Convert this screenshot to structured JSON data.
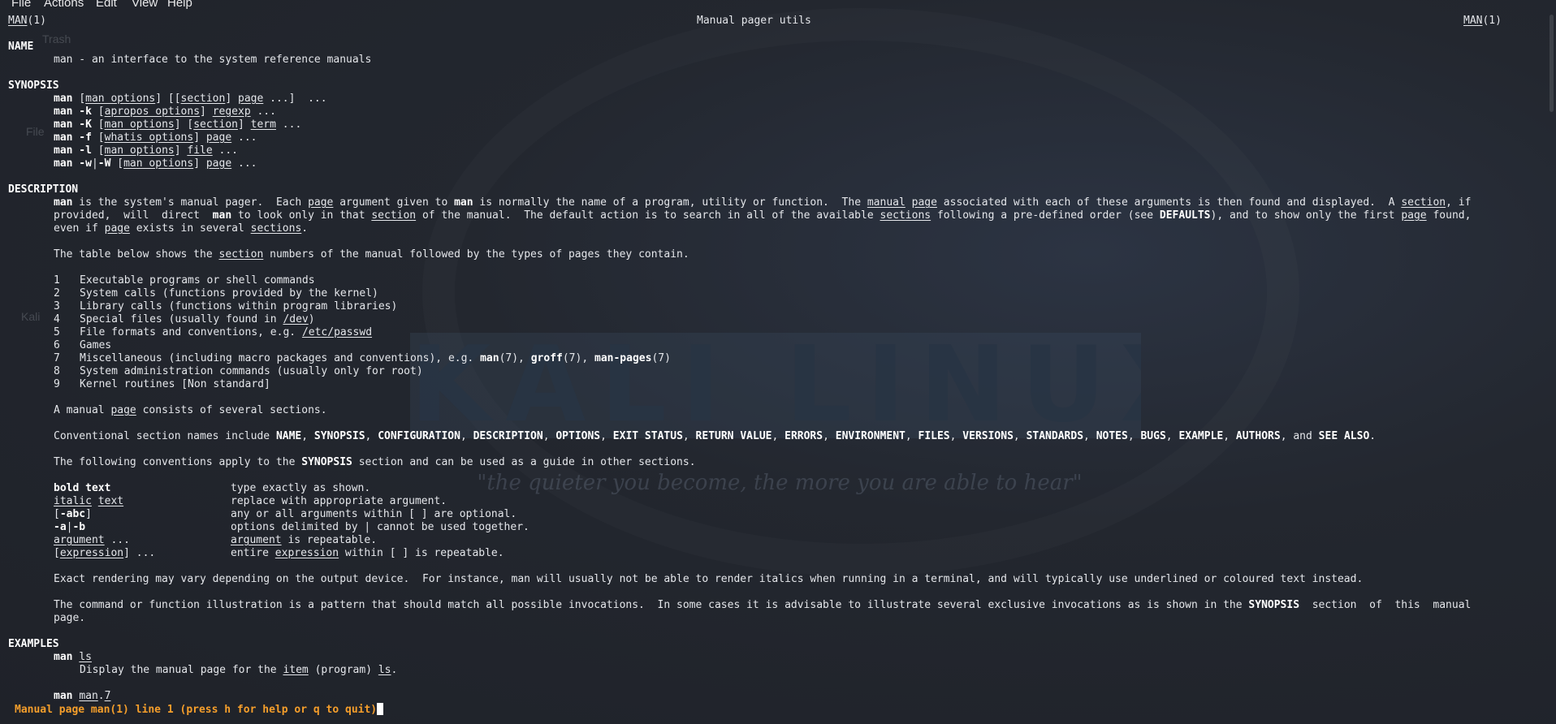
{
  "menubar": {
    "items": [
      "File",
      "Actions",
      "Edit",
      "View",
      "Help"
    ]
  },
  "desktop": {
    "icon_labels": [
      "Trash",
      "File",
      "Kali"
    ],
    "wallpaper_title": "KALI LINUX",
    "wallpaper_quote": "\"the quieter you become, the more you are able to hear\""
  },
  "header": {
    "left_name": "MAN",
    "left_sect": "(1)",
    "center": "Manual pager utils",
    "right_name": "MAN",
    "right_sect": "(1)"
  },
  "sections": {
    "name": "NAME",
    "synopsis": "SYNOPSIS",
    "description": "DESCRIPTION",
    "examples": "EXAMPLES"
  },
  "name_line": "man - an interface to the system reference manuals",
  "synopsis": {
    "man": "man",
    "man_k": "man -k",
    "man_K": "man -K",
    "man_f": "man -f",
    "man_l": "man -l",
    "man_w": "man -w",
    "bar": "|",
    "man_W": "-W",
    "man_options": "man options",
    "section": "section",
    "page": "page",
    "apropos_options": "apropos options",
    "regexp": "regexp",
    "term": "term",
    "whatis_options": "whatis options",
    "file": "file",
    "ellipsis": "...",
    "lb": "[",
    "rb": "]",
    "llb": "[[",
    "sep": "] ",
    "tail": " ...",
    "tail2": " ...]  ...",
    "sp": " "
  },
  "description": {
    "p1": {
      "w_man": "man",
      "t1": " is the system's manual pager.  Each ",
      "w_page": "page",
      "t2": " argument given to ",
      "w_man2": "man",
      "t3": " is normally the name of a program, utility or function.  The ",
      "w_manual": "manual",
      "t4": " ",
      "w_page2": "page",
      "t5": " associated with each of these arguments is then found and displayed.  A ",
      "w_section": "section",
      "t6": ", if",
      "l2a": "provided,  will  direct  ",
      "l2_man": "man",
      "l2b": " to look only in that ",
      "l2_section": "section",
      "l2c": " of the manual.  The default action is to search in all of the available ",
      "l2_sections": "sections",
      "l2d": " following a pre-defined order (see ",
      "l2_defaults": "DEFAULTS",
      "l2e": "), and to show only the first ",
      "l2_page": "page",
      "l2f": " found,",
      "l3a": "even if ",
      "l3_page": "page",
      "l3b": " exists in several ",
      "l3_sections": "sections",
      "l3c": "."
    },
    "p2": {
      "a": "The table below shows the ",
      "w_section": "section",
      "b": " numbers of the manual followed by the types of pages they contain."
    },
    "table": [
      {
        "num": "1",
        "text": "Executable programs or shell commands"
      },
      {
        "num": "2",
        "text": "System calls (functions provided by the kernel)"
      },
      {
        "num": "3",
        "text": "Library calls (functions within program libraries)"
      },
      {
        "num": "4",
        "text": "Special files (usually found in ",
        "u": "/dev",
        "after": ")"
      },
      {
        "num": "5",
        "text": "File formats and conventions, e.g. ",
        "u": "/etc/passwd",
        "after": ""
      },
      {
        "num": "6",
        "text": "Games"
      },
      {
        "num": "7",
        "text": "Miscellaneous (including macro packages and conventions), e.g. "
      },
      {
        "num": "8",
        "text": "System administration commands (usually only for root)"
      },
      {
        "num": "9",
        "text": "Kernel routines [Non standard]"
      }
    ],
    "row7": {
      "man": "man",
      "man_s": "(7), ",
      "groff": "groff",
      "groff_s": "(7), ",
      "manpages": "man-pages",
      "manpages_s": "(7)"
    },
    "p3": {
      "a": "A manual ",
      "w_page": "page",
      "b": " consists of several sections."
    },
    "p4": {
      "a": "Conventional section names include ",
      "names": [
        "NAME",
        "SYNOPSIS",
        "CONFIGURATION",
        "DESCRIPTION",
        "OPTIONS",
        "EXIT STATUS",
        "RETURN VALUE",
        "ERRORS",
        "ENVIRONMENT",
        "FILES",
        "VERSIONS",
        "STANDARDS",
        "NOTES",
        "BUGS",
        "EXAMPLE",
        "AUTHORS"
      ],
      "sep": ", ",
      "and": ", and ",
      "last": "SEE ALSO",
      "end": "."
    },
    "p5": {
      "a": "The following conventions apply to the ",
      "w": "SYNOPSIS",
      "b": " section and can be used as a guide in other sections."
    },
    "conventions": {
      "r1_term": "bold text",
      "r1_desc": "type exactly as shown.",
      "r2_term_a": "italic",
      "r2_term_b": "text",
      "r2_desc": "replace with appropriate argument.",
      "r3_lb": "[",
      "r3_term": "-abc",
      "r3_rb": "]",
      "r3_desc": "any or all arguments within [ ] are optional.",
      "r4_a": "-a",
      "r4_bar": "|",
      "r4_b": "-b",
      "r4_desc": "options delimited by | cannot be used together.",
      "r5_term": "argument",
      "r5_ell": " ...",
      "r5_desc_u": "argument",
      "r5_desc": " is repeatable.",
      "r6_lb": "[",
      "r6_term": "expression",
      "r6_rb": "] ...",
      "r6_desc_a": "entire ",
      "r6_desc_u": "expression",
      "r6_desc_b": " within [ ] is repeatable."
    },
    "p6": "Exact rendering may vary depending on the output device.  For instance, man will usually not be able to render italics when running in a terminal, and will typically use underlined or coloured text instead.",
    "p7": {
      "a": "The command or function illustration is a pattern that should match all possible invocations.  In some cases it is advisable to illustrate several exclusive invocations as is shown in the ",
      "w": "SYNOPSIS",
      "b": "  section  of  this  manual",
      "l2": "page."
    }
  },
  "examples": {
    "e1_cmd": "man",
    "e1_arg": "ls",
    "e1_desc_a": "Display the manual page for the ",
    "e1_item": "item",
    "e1_desc_b": " (program) ",
    "e1_ls": "ls",
    "e1_desc_c": ".",
    "e2_cmd": "man",
    "e2_arg_a": "man",
    "e2_dot": ".",
    "e2_arg_b": "7"
  },
  "status_line": "Manual page man(1) line 1 (press h for help or q to quit)"
}
